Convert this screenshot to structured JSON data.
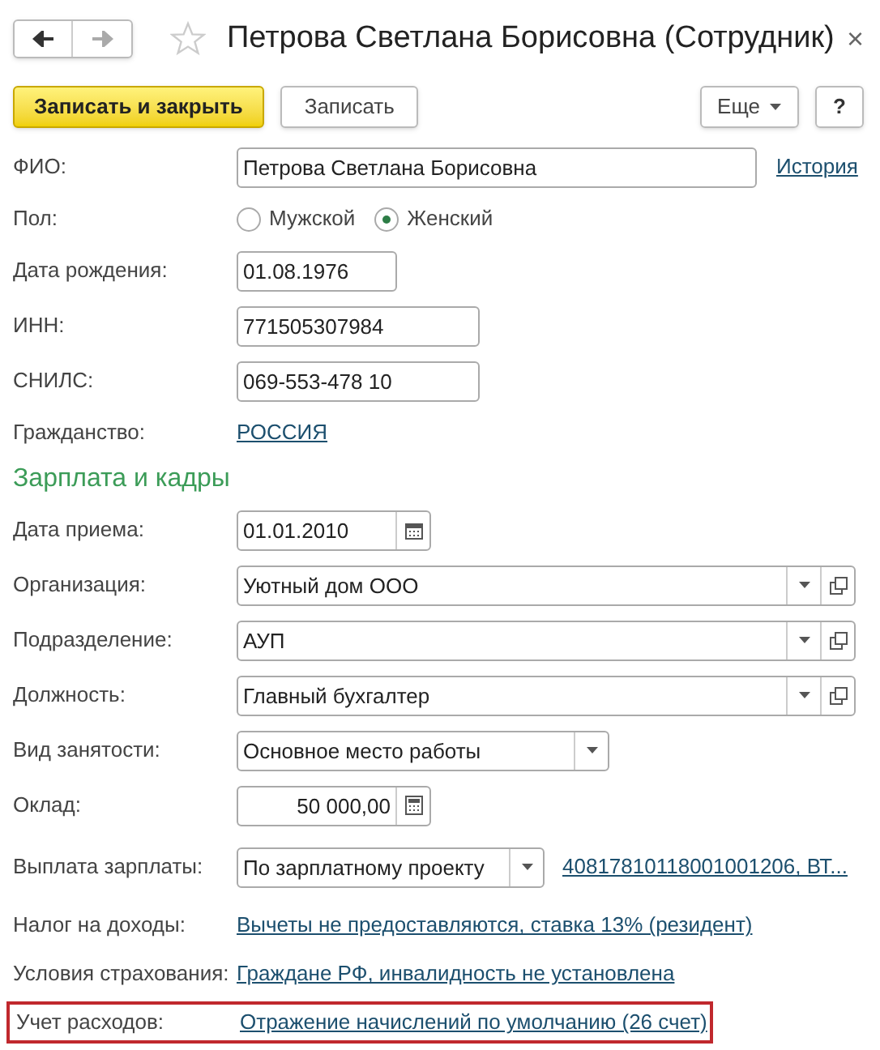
{
  "window": {
    "title": "Петрова Светлана Борисовна (Сотрудник)",
    "close": "×"
  },
  "toolbar": {
    "buttons": [
      {
        "label": "Записать и закрыть",
        "kind": "primary"
      },
      {
        "label": "Записать",
        "kind": "normal"
      }
    ],
    "more": "Еще",
    "help": "?"
  },
  "fields": [
    {
      "kind": "text",
      "label": "ФИО:",
      "value": "Петрова Светлана Борисовна",
      "link": "История",
      "highlighted": false
    },
    {
      "kind": "radio",
      "label": "Пол:",
      "options": [
        {
          "label": "Мужской",
          "selected": false
        },
        {
          "label": "Женский",
          "selected": true
        }
      ],
      "highlighted": false
    },
    {
      "kind": "text",
      "label": "Дата рождения:",
      "value": "01.08.1976",
      "highlighted": false
    },
    {
      "kind": "text",
      "label": "ИНН:",
      "value": "771505307984",
      "highlighted": false
    },
    {
      "kind": "text",
      "label": "СНИЛС:",
      "value": "069-553-478 10",
      "highlighted": false
    },
    {
      "kind": "link",
      "label": "Гражданство:",
      "value": "РОССИЯ",
      "highlighted": false
    },
    {
      "kind": "section",
      "label": "Зарплата и кадры"
    },
    {
      "kind": "date",
      "label": "Дата приема:",
      "value": "01.01.2010",
      "highlighted": false
    },
    {
      "kind": "reference",
      "label": "Организация:",
      "value": "Уютный дом ООО",
      "highlighted": false
    },
    {
      "kind": "reference",
      "label": "Подразделение:",
      "value": "АУП",
      "highlighted": false
    },
    {
      "kind": "reference",
      "label": "Должность:",
      "value": "Главный бухгалтер",
      "highlighted": false
    },
    {
      "kind": "select",
      "label": "Вид занятости:",
      "value": "Основное место работы",
      "highlighted": false
    },
    {
      "kind": "number",
      "label": "Оклад:",
      "value": "50 000,00",
      "highlighted": false
    },
    {
      "kind": "select",
      "label": "Выплата зарплаты:",
      "value": "По зарплатному проекту",
      "link": "40817810118001001206, ВТ...",
      "highlighted": false
    },
    {
      "kind": "link",
      "label": "Налог на доходы:",
      "value": "Вычеты не предоставляются, ставка 13% (резидент)",
      "highlighted": false
    },
    {
      "kind": "link",
      "label": "Условия страхования:",
      "value": "Граждане РФ, инвалидность не установлена",
      "highlighted": false
    },
    {
      "kind": "link",
      "label": "Учет расходов:",
      "value": "Отражение начислений по умолчанию (26 счет)",
      "highlighted": true
    }
  ]
}
